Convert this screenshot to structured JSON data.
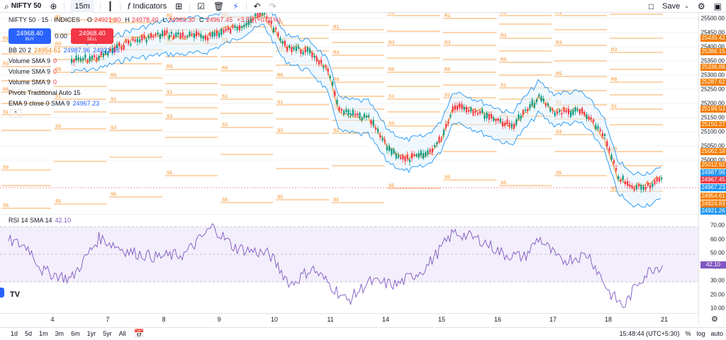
{
  "toolbar": {
    "symbol": "NIFTY 50",
    "timeframe": "15m",
    "indicators_label": "Indicators",
    "save_label": "Save"
  },
  "header": {
    "instrument": "NIFTY 50 · 15 · INDICES",
    "ohlc": {
      "o_label": "O",
      "o": "24921.00",
      "h_label": "H",
      "h": "24978.40",
      "l_label": "L",
      "l": "24963.30",
      "c_label": "C",
      "c": "24967.45",
      "change": "+3.55 (+0.01%)"
    },
    "buy_price": "24968.40",
    "buy_label": "BUY",
    "sell_price": "24968.40",
    "sell_label": "SELL",
    "spread": "0.00"
  },
  "indicators": [
    {
      "name": "BB 20 2",
      "values": [
        "24954.61",
        "24987.96",
        "24921.26"
      ]
    },
    {
      "name": "Volume SMA 9",
      "values": [
        "0"
      ]
    },
    {
      "name": "Volume SMA 9",
      "values": [
        "0"
      ]
    },
    {
      "name": "Volume SMA 9",
      "values": [
        "0"
      ]
    },
    {
      "name": "Pivots Traditional Auto 15",
      "values": []
    },
    {
      "name": "EMA 9 close 0 SMA 9",
      "values": [
        "24967.23"
      ]
    }
  ],
  "rsi": {
    "name": "RSI 14 SMA 14",
    "value": "42.10"
  },
  "price_axis": {
    "labels": [
      "25500.00",
      "25450.00",
      "25400.00",
      "25350.00",
      "25300.00",
      "25250.00",
      "25200.00",
      "25150.00",
      "25100.00",
      "25050.00",
      "25000.00"
    ],
    "tags": [
      {
        "text": "25435.42",
        "color": "#f57c00"
      },
      {
        "text": "25386.15",
        "color": "#f57c00"
      },
      {
        "text": "25336.88",
        "color": "#f57c00"
      },
      {
        "text": "25287.62",
        "color": "#f57c00"
      },
      {
        "text": "25199.53",
        "color": "#f57c00"
      },
      {
        "text": "25150.27",
        "color": "#f57c00"
      },
      {
        "text": "25062.18",
        "color": "#f57c00"
      },
      {
        "text": "25012.92",
        "color": "#f57c00"
      },
      {
        "text": "24987.96",
        "color": "#2196f3"
      },
      {
        "text": "24967.45",
        "color": "#f23645"
      },
      {
        "text": "24967.23",
        "color": "#2196f3"
      },
      {
        "text": "24954.61",
        "color": "#f57c00"
      },
      {
        "text": "24924.83",
        "color": "#f57c00"
      },
      {
        "text": "24921.26",
        "color": "#2196f3"
      }
    ]
  },
  "rsi_axis": {
    "labels": [
      "70.00",
      "60.00",
      "50.00",
      "40.00",
      "30.00",
      "20.00",
      "10.00"
    ],
    "tag": "42.10"
  },
  "date_axis": [
    "4",
    "7",
    "8",
    "9",
    "10",
    "11",
    "14",
    "15",
    "16",
    "17",
    "18",
    "21"
  ],
  "bottom": {
    "ranges": [
      "1d",
      "5d",
      "1m",
      "3m",
      "6m",
      "1yr",
      "5yr",
      "All"
    ],
    "time": "15:48:44 (UTC+5:30)",
    "pct": "%",
    "log": "log",
    "auto": "auto"
  },
  "pivot_labels": [
    "R1",
    "R2",
    "R3",
    "R4",
    "R5",
    "P",
    "S1",
    "S2",
    "S3",
    "S4",
    "S5"
  ],
  "logo_text": "TV",
  "colors": {
    "up": "#089981",
    "down": "#f23645",
    "bb": "#2196f3",
    "bb_fill": "#e3f2fd",
    "ema": "#f57c00",
    "pivot": "#f57c00",
    "rsi_line": "#7e57c2",
    "rsi_band": "#f3eefb"
  }
}
